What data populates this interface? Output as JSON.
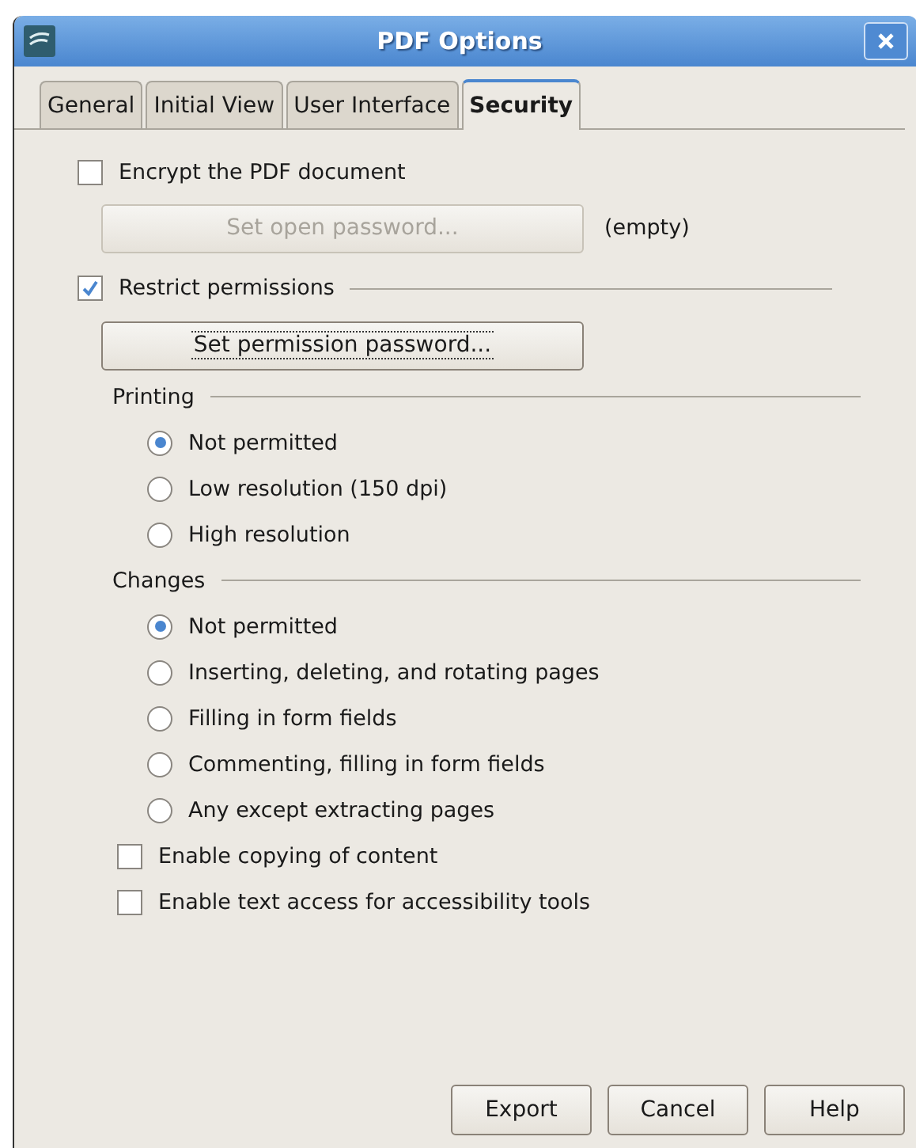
{
  "window": {
    "title": "PDF Options"
  },
  "tabs": [
    {
      "label": "General",
      "selected": false
    },
    {
      "label": "Initial View",
      "selected": false
    },
    {
      "label": "User Interface",
      "selected": false
    },
    {
      "label": "Security",
      "selected": true
    }
  ],
  "encrypt": {
    "label": "Encrypt the PDF document",
    "checked": false,
    "button": {
      "label": "Set open password...",
      "disabled": true
    },
    "status": "(empty)"
  },
  "restrict": {
    "label": "Restrict permissions",
    "checked": true,
    "button": {
      "label": "Set permission password...",
      "disabled": false
    }
  },
  "groups": [
    {
      "title": "Printing",
      "options": [
        {
          "label": "Not permitted",
          "selected": true
        },
        {
          "label": "Low resolution (150 dpi)",
          "selected": false
        },
        {
          "label": "High resolution",
          "selected": false
        }
      ]
    },
    {
      "title": "Changes",
      "options": [
        {
          "label": "Not permitted",
          "selected": true
        },
        {
          "label": "Inserting, deleting, and rotating pages",
          "selected": false
        },
        {
          "label": "Filling in form fields",
          "selected": false
        },
        {
          "label": "Commenting, filling in form fields",
          "selected": false
        },
        {
          "label": "Any except extracting pages",
          "selected": false
        }
      ]
    }
  ],
  "options": [
    {
      "label": "Enable copying of content",
      "checked": false
    },
    {
      "label": "Enable text access for accessibility tools",
      "checked": false
    }
  ],
  "buttons": [
    "Export",
    "Cancel",
    "Help"
  ]
}
